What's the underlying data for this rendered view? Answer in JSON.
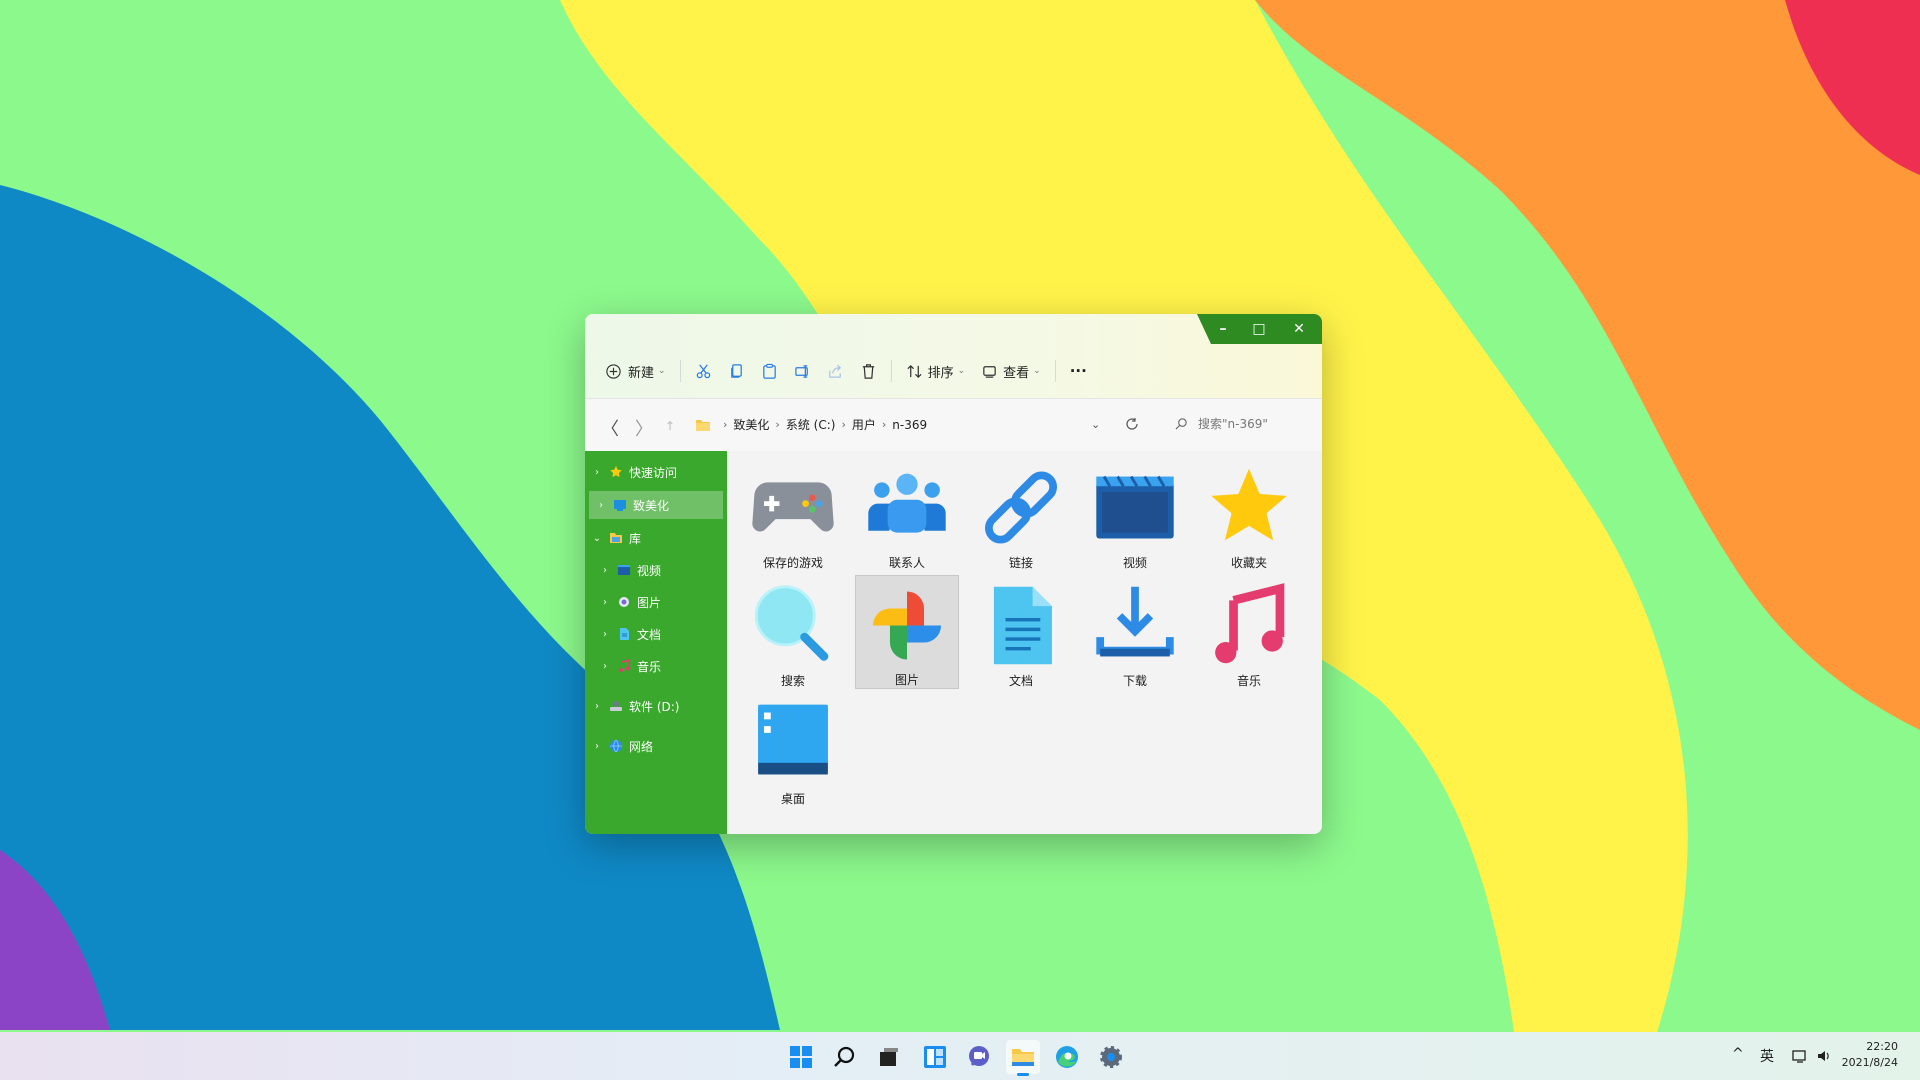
{
  "window": {
    "caption": {
      "minimize": "–",
      "maximize": "□",
      "close": "✕"
    },
    "toolbar": {
      "new_label": "新建",
      "sort_label": "排序",
      "view_label": "查看",
      "more_label": "···"
    },
    "address": {
      "back": "〈",
      "forward": "〉",
      "breadcrumb": [
        "致美化",
        "系统 (C:)",
        "用户",
        "n-369"
      ],
      "search_placeholder": "搜索\"n-369\""
    },
    "sidebar": {
      "items": [
        {
          "label": "快速访问",
          "icon": "star-icon"
        },
        {
          "label": "致美化",
          "icon": "desktop-icon"
        },
        {
          "label": "库",
          "icon": "library-folder-icon"
        },
        {
          "label": "视频",
          "icon": "video-icon"
        },
        {
          "label": "图片",
          "icon": "picture-icon"
        },
        {
          "label": "文档",
          "icon": "document-icon"
        },
        {
          "label": "音乐",
          "icon": "music-icon"
        },
        {
          "label": "软件 (D:)",
          "icon": "drive-icon"
        },
        {
          "label": "网络",
          "icon": "network-icon"
        }
      ]
    },
    "folders": [
      {
        "label": "保存的游戏",
        "icon": "gamepad-icon"
      },
      {
        "label": "联系人",
        "icon": "contacts-icon"
      },
      {
        "label": "链接",
        "icon": "link-icon"
      },
      {
        "label": "视频",
        "icon": "video-clapper-icon"
      },
      {
        "label": "收藏夹",
        "icon": "star-icon"
      },
      {
        "label": "搜索",
        "icon": "magnifier-icon"
      },
      {
        "label": "图片",
        "icon": "photos-pinwheel-icon"
      },
      {
        "label": "文档",
        "icon": "document-icon"
      },
      {
        "label": "下载",
        "icon": "download-icon"
      },
      {
        "label": "音乐",
        "icon": "music-note-icon"
      },
      {
        "label": "桌面",
        "icon": "desktop-icon"
      }
    ]
  },
  "taskbar": {
    "input_method": "英",
    "time": "22:20",
    "date": "2021/8/24",
    "tray_chevron": "^"
  },
  "colors": {
    "sidebar_green": "#3aa82d",
    "caption_green": "#2e8b22"
  }
}
